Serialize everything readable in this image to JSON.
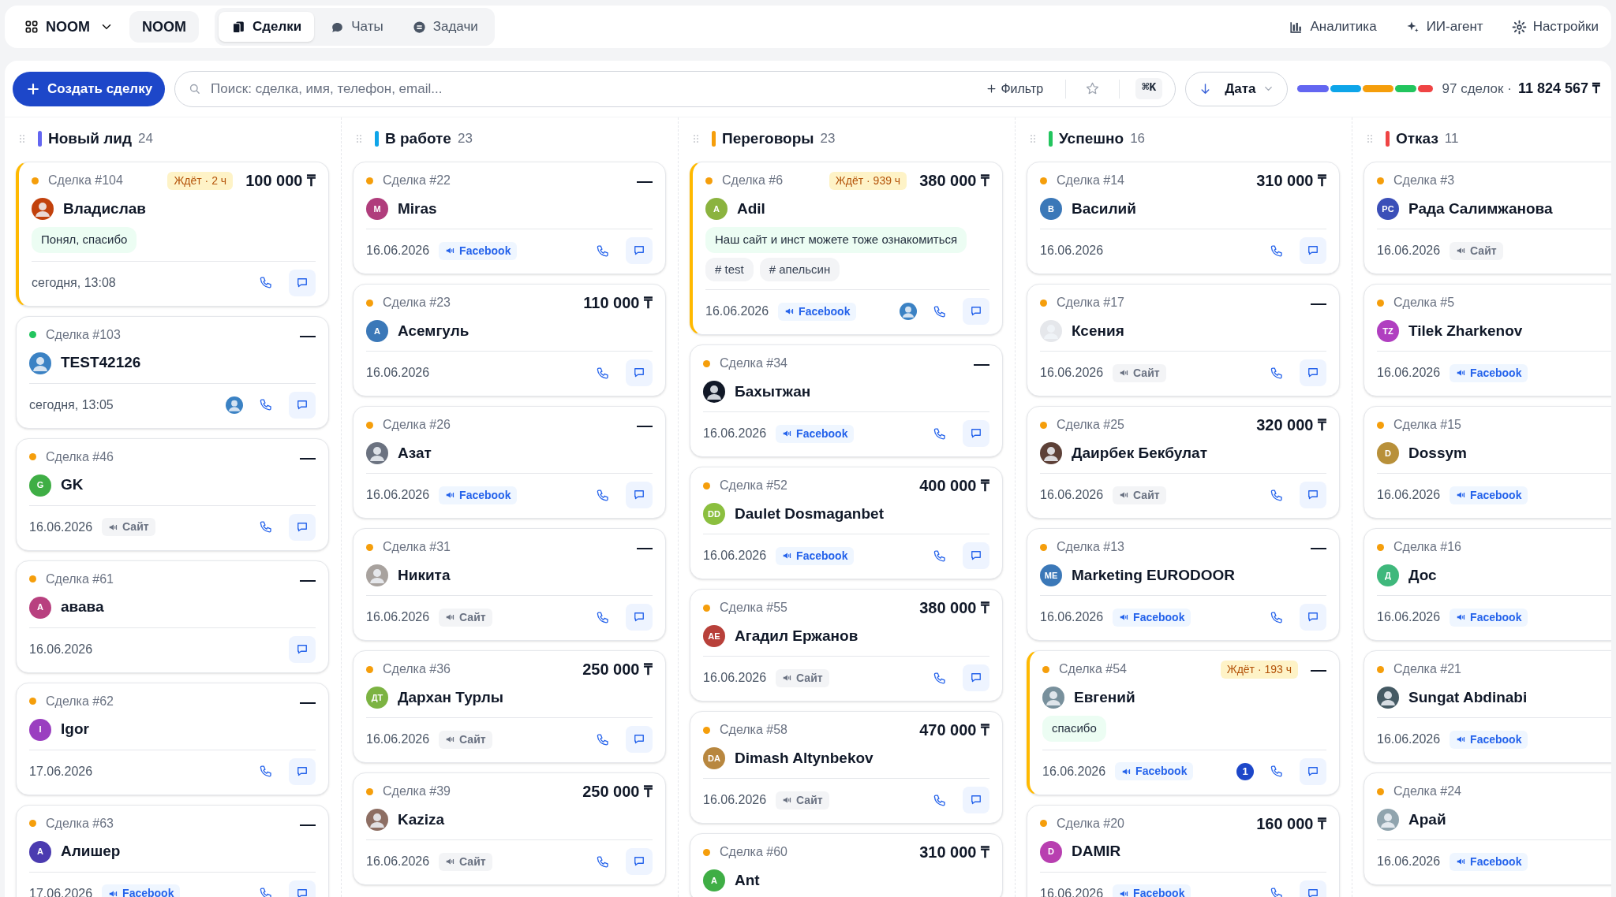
{
  "workspace": {
    "label": "NOOM"
  },
  "workspace_badge": "NOOM",
  "tabs": [
    {
      "label": "Сделки",
      "kind": "deals",
      "selected": true
    },
    {
      "label": "Чаты",
      "kind": "chats",
      "selected": false
    },
    {
      "label": "Задачи",
      "kind": "tasks",
      "selected": false
    }
  ],
  "nav_links": [
    {
      "label": "Аналитика",
      "kind": "analytics"
    },
    {
      "label": "ИИ-агент",
      "kind": "sparkle"
    },
    {
      "label": "Настройки",
      "kind": "settings"
    }
  ],
  "create_button": "Создать сделку",
  "search": {
    "placeholder": "Поиск: сделка, имя, телефон, email..."
  },
  "filter_button": "Фильтр",
  "shortcut": "⌘K",
  "sort": {
    "label": "Дата"
  },
  "summary": {
    "count": "97 сделок ·",
    "total": "11 824 567 ₸"
  },
  "columns": [
    {
      "title": "Новый лид",
      "count": "24",
      "color": "#6366f1",
      "deals": [
        {
          "number": "Сделка #104",
          "color": "#f59e0b",
          "waiting": "Ждёт · 2 ч",
          "amount": "100 000 ₸",
          "name": "Владислав",
          "avatar": {
            "kind": "photo",
            "color": "#c2410c"
          },
          "message": "Понял, спасибо",
          "date": "сегодня, 13:08",
          "phone": true,
          "chat": true,
          "highlighted": true
        },
        {
          "number": "Сделка #103",
          "color": "#22c55e",
          "amount": "—",
          "name": "TEST42126",
          "avatar": {
            "kind": "photo",
            "color": "#3b82c4"
          },
          "date": "сегодня, 13:05",
          "assignee": true,
          "phone": true,
          "chat": true,
          "highlighted": false
        },
        {
          "number": "Сделка #46",
          "color": "#f59e0b",
          "amount": "—",
          "name": "GK",
          "avatar": {
            "kind": "initials",
            "text": "G",
            "color": "#3fae45"
          },
          "date": "16.06.2026",
          "source": {
            "label": "Сайт",
            "kind": "site"
          },
          "phone": true,
          "chat": true,
          "highlighted": false
        },
        {
          "number": "Сделка #61",
          "color": "#f59e0b",
          "amount": "—",
          "name": "авава",
          "avatar": {
            "kind": "initials",
            "text": "A",
            "color": "#b8407f"
          },
          "date": "16.06.2026",
          "phone": false,
          "chat": true,
          "highlighted": false
        },
        {
          "number": "Сделка #62",
          "color": "#f59e0b",
          "amount": "—",
          "name": "Igor",
          "avatar": {
            "kind": "initials",
            "text": "I",
            "color": "#9a3fc0"
          },
          "date": "17.06.2026",
          "phone": true,
          "chat": true,
          "highlighted": false
        },
        {
          "number": "Сделка #63",
          "color": "#f59e0b",
          "amount": "—",
          "name": "Алишер",
          "avatar": {
            "kind": "initials",
            "text": "A",
            "color": "#4b3bb0"
          },
          "date": "17.06.2026",
          "source": {
            "label": "Facebook",
            "kind": "facebook"
          },
          "phone": true,
          "chat": true,
          "highlighted": false
        }
      ]
    },
    {
      "title": "В работе",
      "count": "23",
      "color": "#0ea5e9",
      "deals": [
        {
          "number": "Сделка #22",
          "color": "#f59e0b",
          "amount": "—",
          "name": "Miras",
          "avatar": {
            "kind": "initials",
            "text": "M",
            "color": "#b03d7c"
          },
          "date": "16.06.2026",
          "source": {
            "label": "Facebook",
            "kind": "facebook"
          },
          "phone": true,
          "chat": true,
          "highlighted": false
        },
        {
          "number": "Сделка #23",
          "color": "#f59e0b",
          "amount": "110 000 ₸",
          "name": "Асемгуль",
          "avatar": {
            "kind": "initials",
            "text": "A",
            "color": "#3b78b8"
          },
          "date": "16.06.2026",
          "phone": true,
          "chat": true,
          "highlighted": false
        },
        {
          "number": "Сделка #26",
          "color": "#f59e0b",
          "amount": "—",
          "name": "Азат",
          "avatar": {
            "kind": "photo",
            "color": "#6b7280"
          },
          "date": "16.06.2026",
          "source": {
            "label": "Facebook",
            "kind": "facebook"
          },
          "phone": true,
          "chat": true,
          "highlighted": false
        },
        {
          "number": "Сделка #31",
          "color": "#f59e0b",
          "amount": "—",
          "name": "Никита",
          "avatar": {
            "kind": "photo",
            "color": "#a8a29e"
          },
          "date": "16.06.2026",
          "source": {
            "label": "Сайт",
            "kind": "site"
          },
          "phone": true,
          "chat": true,
          "highlighted": false
        },
        {
          "number": "Сделка #36",
          "color": "#f59e0b",
          "amount": "250 000 ₸",
          "name": "Дархан Турлы",
          "avatar": {
            "kind": "initials",
            "text": "ДТ",
            "color": "#7cb342"
          },
          "date": "16.06.2026",
          "source": {
            "label": "Сайт",
            "kind": "site"
          },
          "phone": true,
          "chat": true,
          "highlighted": false
        },
        {
          "number": "Сделка #39",
          "color": "#f59e0b",
          "amount": "250 000 ₸",
          "name": "Kaziza",
          "avatar": {
            "kind": "photo",
            "color": "#8d6e63"
          },
          "date": "16.06.2026",
          "source": {
            "label": "Сайт",
            "kind": "site"
          },
          "phone": true,
          "chat": true,
          "highlighted": false
        }
      ]
    },
    {
      "title": "Переговоры",
      "count": "23",
      "color": "#f59e0b",
      "deals": [
        {
          "number": "Сделка #6",
          "color": "#f59e0b",
          "waiting": "Ждёт · 939 ч",
          "amount": "380 000 ₸",
          "name": "Adil",
          "avatar": {
            "kind": "initials",
            "text": "A",
            "color": "#8bb33f"
          },
          "message": "Наш сайт и инст можете тоже ознакомиться",
          "tags": [
            "# test",
            "# апельсин"
          ],
          "date": "16.06.2026",
          "source": {
            "label": "Facebook",
            "kind": "facebook"
          },
          "assignee": true,
          "phone": true,
          "chat": true,
          "highlighted": true
        },
        {
          "number": "Сделка #34",
          "color": "#f59e0b",
          "amount": "—",
          "name": "Бахытжан",
          "avatar": {
            "kind": "photo",
            "color": "#111827"
          },
          "date": "16.06.2026",
          "source": {
            "label": "Facebook",
            "kind": "facebook"
          },
          "phone": true,
          "chat": true,
          "highlighted": false
        },
        {
          "number": "Сделка #52",
          "color": "#f59e0b",
          "amount": "400 000 ₸",
          "name": "Daulet Dosmaganbet",
          "avatar": {
            "kind": "initials",
            "text": "DD",
            "color": "#8bbf3f"
          },
          "date": "16.06.2026",
          "source": {
            "label": "Facebook",
            "kind": "facebook"
          },
          "phone": true,
          "chat": true,
          "highlighted": false
        },
        {
          "number": "Сделка #55",
          "color": "#f59e0b",
          "amount": "380 000 ₸",
          "name": "Агадил Ержанов",
          "avatar": {
            "kind": "initials",
            "text": "AE",
            "color": "#b8403a"
          },
          "date": "16.06.2026",
          "source": {
            "label": "Сайт",
            "kind": "site"
          },
          "phone": true,
          "chat": true,
          "highlighted": false
        },
        {
          "number": "Сделка #58",
          "color": "#f59e0b",
          "amount": "470 000 ₸",
          "name": "Dimash Altynbekov",
          "avatar": {
            "kind": "initials",
            "text": "DA",
            "color": "#b8873f"
          },
          "date": "16.06.2026",
          "source": {
            "label": "Сайт",
            "kind": "site"
          },
          "phone": true,
          "chat": true,
          "highlighted": false
        },
        {
          "number": "Сделка #60",
          "color": "#f59e0b",
          "amount": "310 000 ₸",
          "name": "Ant",
          "avatar": {
            "kind": "initials",
            "text": "A",
            "color": "#3fae45"
          },
          "phone": false,
          "chat": false,
          "highlighted": false
        }
      ]
    },
    {
      "title": "Успешно",
      "count": "16",
      "color": "#22c55e",
      "deals": [
        {
          "number": "Сделка #14",
          "color": "#f59e0b",
          "amount": "310 000 ₸",
          "name": "Василий",
          "avatar": {
            "kind": "initials",
            "text": "B",
            "color": "#3b78b8"
          },
          "date": "16.06.2026",
          "phone": true,
          "chat": true,
          "highlighted": false
        },
        {
          "number": "Сделка #17",
          "color": "#f59e0b",
          "amount": "—",
          "name": "Ксения",
          "avatar": {
            "kind": "photo",
            "color": "#e5e7eb"
          },
          "date": "16.06.2026",
          "source": {
            "label": "Сайт",
            "kind": "site"
          },
          "phone": true,
          "chat": true,
          "highlighted": false
        },
        {
          "number": "Сделка #25",
          "color": "#f59e0b",
          "amount": "320 000 ₸",
          "name": "Даирбек Бекбулат",
          "avatar": {
            "kind": "photo",
            "color": "#5d4037"
          },
          "date": "16.06.2026",
          "source": {
            "label": "Сайт",
            "kind": "site"
          },
          "phone": true,
          "chat": true,
          "highlighted": false
        },
        {
          "number": "Сделка #13",
          "color": "#f59e0b",
          "amount": "—",
          "name": "Marketing EURODOOR",
          "avatar": {
            "kind": "initials",
            "text": "ME",
            "color": "#3b78b8"
          },
          "date": "16.06.2026",
          "source": {
            "label": "Facebook",
            "kind": "facebook"
          },
          "phone": true,
          "chat": true,
          "highlighted": false
        },
        {
          "number": "Сделка #54",
          "color": "#f59e0b",
          "waiting": "Ждёт · 193 ч",
          "amount": "—",
          "name": "Евгений",
          "avatar": {
            "kind": "photo",
            "color": "#78909c"
          },
          "message": "спасибо",
          "date": "16.06.2026",
          "source": {
            "label": "Facebook",
            "kind": "facebook"
          },
          "unread": "1",
          "phone": true,
          "chat": true,
          "highlighted": true
        },
        {
          "number": "Сделка #20",
          "color": "#f59e0b",
          "amount": "160 000 ₸",
          "name": "DAMIR",
          "avatar": {
            "kind": "initials",
            "text": "D",
            "color": "#b83fb0"
          },
          "date": "16.06.2026",
          "source": {
            "label": "Facebook",
            "kind": "facebook"
          },
          "phone": true,
          "chat": true,
          "highlighted": false
        }
      ]
    },
    {
      "title": "Отказ",
      "count": "11",
      "color": "#ef4444",
      "deals": [
        {
          "number": "Сделка #3",
          "color": "#f59e0b",
          "name": "Рада Салимжанова",
          "avatar": {
            "kind": "initials",
            "text": "PC",
            "color": "#3b4fb8"
          },
          "date": "16.06.2026",
          "source": {
            "label": "Сайт",
            "kind": "site"
          },
          "phone": false,
          "chat": false,
          "highlighted": false
        },
        {
          "number": "Сделка #5",
          "color": "#f59e0b",
          "name": "Tilek Zharkenov",
          "avatar": {
            "kind": "initials",
            "text": "TZ",
            "color": "#b03fc0"
          },
          "date": "16.06.2026",
          "source": {
            "label": "Facebook",
            "kind": "facebook"
          },
          "phone": false,
          "chat": false,
          "highlighted": false
        },
        {
          "number": "Сделка #15",
          "color": "#f59e0b",
          "name": "Dossym",
          "avatar": {
            "kind": "initials",
            "text": "D",
            "color": "#b8903a"
          },
          "date": "16.06.2026",
          "source": {
            "label": "Facebook",
            "kind": "facebook"
          },
          "phone": false,
          "chat": false,
          "highlighted": false
        },
        {
          "number": "Сделка #16",
          "color": "#f59e0b",
          "name": "Дос",
          "avatar": {
            "kind": "initials",
            "text": "Д",
            "color": "#3fb87c"
          },
          "date": "16.06.2026",
          "source": {
            "label": "Facebook",
            "kind": "facebook"
          },
          "phone": false,
          "chat": false,
          "highlighted": false
        },
        {
          "number": "Сделка #21",
          "color": "#f59e0b",
          "name": "Sungat Abdinabi",
          "avatar": {
            "kind": "photo",
            "color": "#455a64"
          },
          "date": "16.06.2026",
          "source": {
            "label": "Facebook",
            "kind": "facebook"
          },
          "phone": false,
          "chat": false,
          "highlighted": false
        },
        {
          "number": "Сделка #24",
          "color": "#f59e0b",
          "name": "Арай",
          "avatar": {
            "kind": "photo",
            "color": "#90a4ae"
          },
          "date": "16.06.2026",
          "source": {
            "label": "Facebook",
            "kind": "facebook"
          },
          "phone": false,
          "chat": false,
          "highlighted": false
        }
      ]
    }
  ]
}
